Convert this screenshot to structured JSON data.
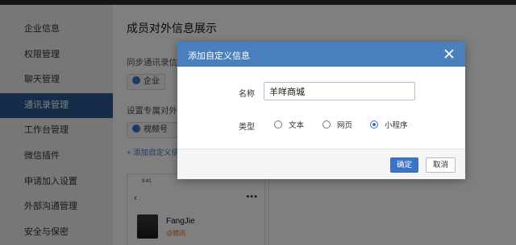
{
  "sidebar": {
    "items": [
      {
        "label": "企业信息"
      },
      {
        "label": "权限管理"
      },
      {
        "label": "聊天管理"
      },
      {
        "label": "通讯录管理"
      },
      {
        "label": "工作台管理"
      },
      {
        "label": "微信插件"
      },
      {
        "label": "申请加入设置"
      },
      {
        "label": "外部沟通管理"
      },
      {
        "label": "安全与保密"
      }
    ],
    "active_index": 3
  },
  "main": {
    "title": "成员对外信息展示",
    "section1_label": "同步通讯录信息",
    "chip1_label": "企业",
    "section2_label": "设置专属对外信",
    "chip2_label": "视频号",
    "add_link": "+ 添加自定义信",
    "phone": {
      "time": "9:41",
      "back": "‹",
      "more": "•••",
      "name": "FangJie",
      "org": "@腾讯"
    }
  },
  "dialog": {
    "title": "添加自定义信息",
    "name_label": "名称",
    "name_value": "羊咩商城",
    "type_label": "类型",
    "type_options": [
      "文本",
      "网页",
      "小程序"
    ],
    "type_selected": "小程序",
    "ok_label": "确定",
    "cancel_label": "取消"
  },
  "colors": {
    "accent": "#3b74c6",
    "header": "#4a7fbd",
    "sidebar_active": "#2c5a93"
  },
  "icons": [
    "close-icon",
    "check-icon"
  ]
}
